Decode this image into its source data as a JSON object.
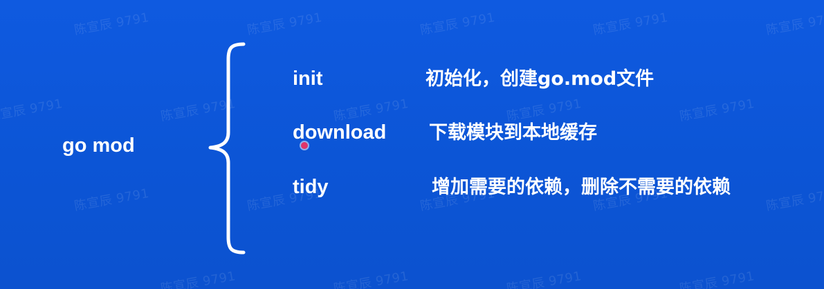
{
  "root": {
    "label": "go mod"
  },
  "commands": [
    {
      "name": "init",
      "description": "初始化，创建go.mod文件"
    },
    {
      "name": "download",
      "description": "下载模块到本地缓存"
    },
    {
      "name": "tidy",
      "description": "增加需要的依赖，删除不需要的依赖"
    }
  ],
  "watermark": {
    "text": "陈宣辰 9791"
  },
  "colors": {
    "background": "#0f58d8",
    "text": "#ffffff",
    "brace": "#ffffff",
    "cursor": "#e0356a"
  }
}
